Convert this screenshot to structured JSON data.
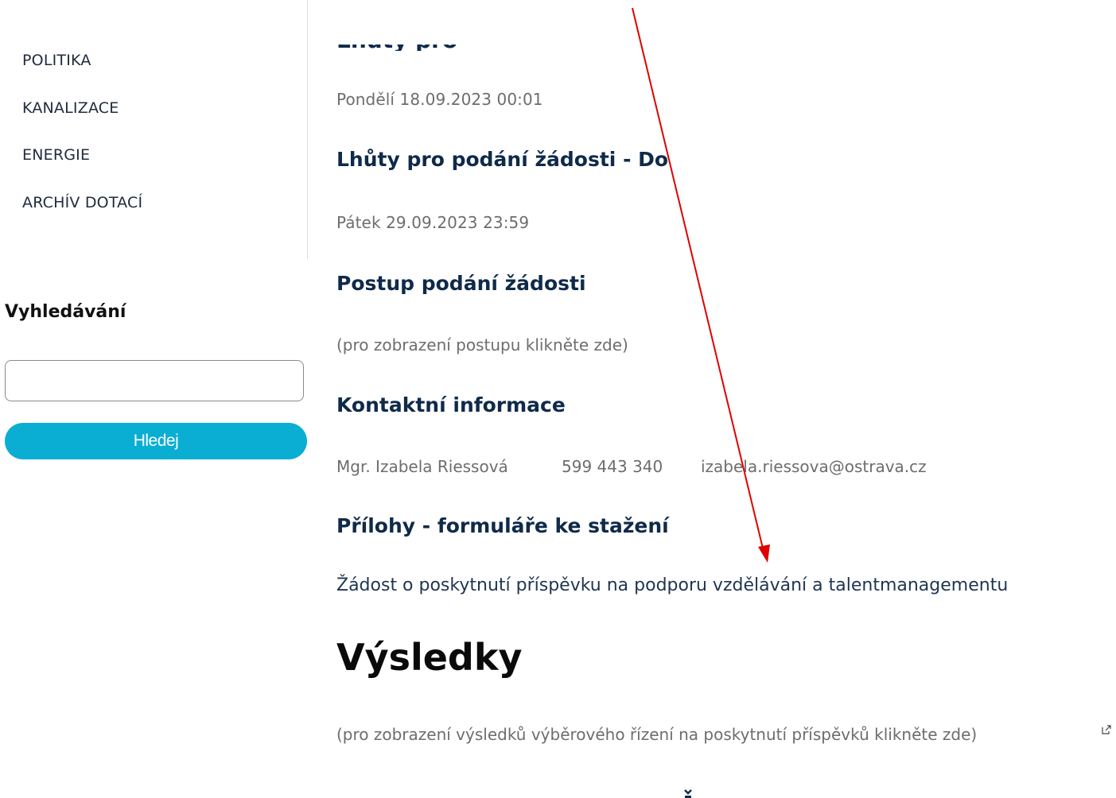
{
  "sidebar": {
    "nav_items": [
      {
        "label": "POLITIKA"
      },
      {
        "label": "KANALIZACE"
      },
      {
        "label": "ENERGIE"
      },
      {
        "label": "ARCHÍV DOTACÍ"
      }
    ],
    "search": {
      "heading": "Vyhledávání",
      "input_value": "",
      "button_label": "Hledej"
    }
  },
  "main": {
    "start_date": "Pondělí 18.09.2023 00:01",
    "deadline_heading": "Lhůty pro podání žádosti - Do",
    "end_date": "Pátek 29.09.2023 23:59",
    "procedure_heading": "Postup podání žádosti",
    "procedure_link": "(pro zobrazení postupu klikněte zde)",
    "contact_heading": "Kontaktní informace",
    "contact": {
      "name": "Mgr. Izabela Riessová",
      "phone": "599 443 340",
      "email": "izabela.riessova@ostrava.cz"
    },
    "attachments_heading": "Přílohy - formuláře ke stažení",
    "attachment_link": "Žádost o poskytnutí příspěvku na podporu vzdělávání a talentmanagementu",
    "results_heading": "Výsledky",
    "results_link": "(pro zobrazení výsledků výběrového řízení na poskytnutí příspěvků klikněte zde)"
  },
  "colors": {
    "heading": "#0f2a4a",
    "muted_text": "#6d6d6d",
    "button": "#0aaed3",
    "annotation": "#e00000"
  },
  "icons": {
    "external_link": "external-link-icon",
    "annotation": "red-arrow-icon"
  }
}
